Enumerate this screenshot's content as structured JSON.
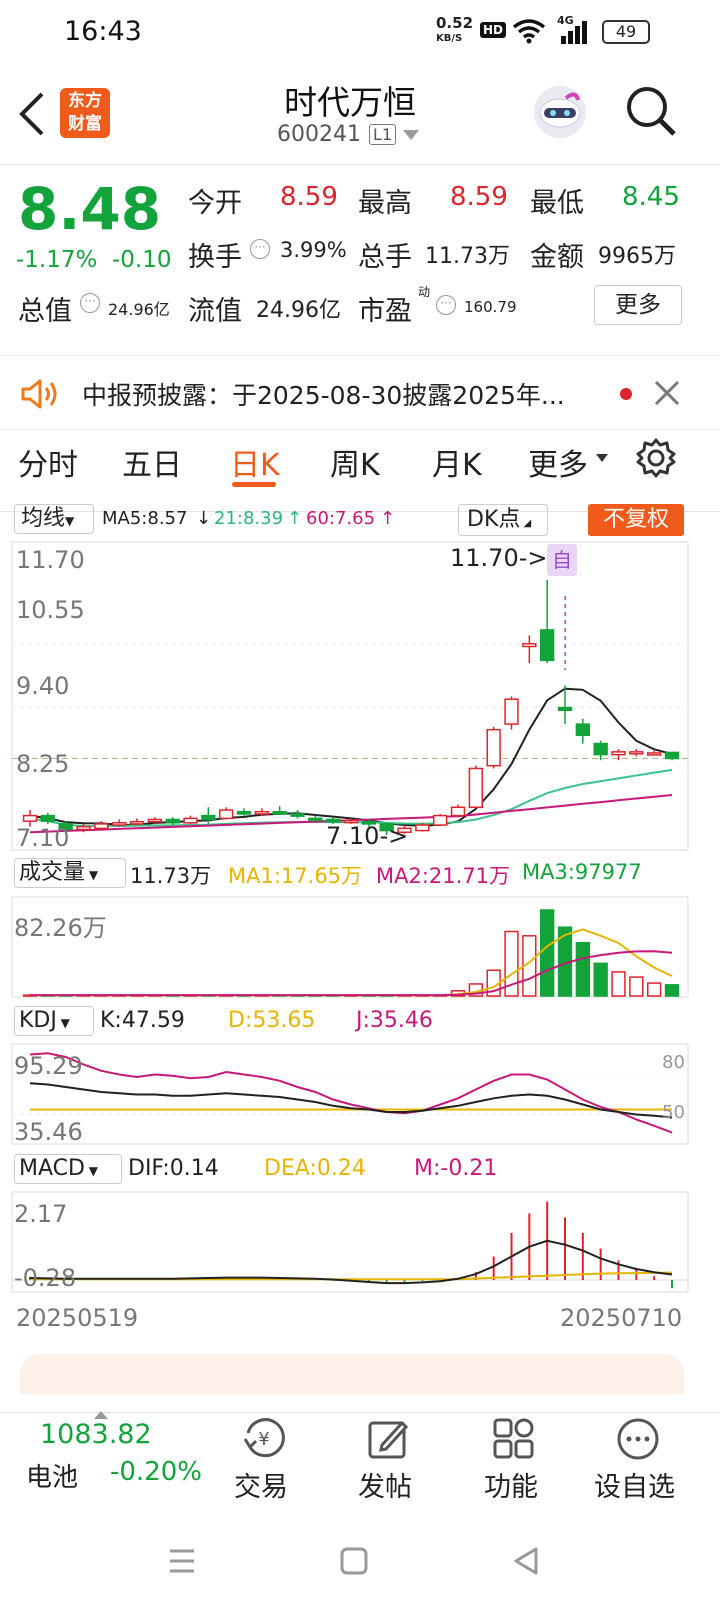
{
  "status_bar": {
    "time": "16:43",
    "net_speed": "0.52",
    "net_unit": "KB/S",
    "hd": "HD",
    "signal": "4G",
    "battery": "49"
  },
  "header": {
    "back_icon": "chevron-left-icon",
    "logo_text_1": "东方",
    "logo_text_2": "财富",
    "title": "时代万恒",
    "code": "600241",
    "level": "L1",
    "robot_icon": "robot-icon",
    "search_icon": "search-icon"
  },
  "quote": {
    "price": "8.48",
    "change_pct": "-1.17%",
    "change": "-0.10",
    "open_label": "今开",
    "open": "8.59",
    "high_label": "最高",
    "high": "8.59",
    "low_label": "最低",
    "low": "8.45",
    "turnover_label": "换手",
    "turnover": "3.99%",
    "volume_label": "总手",
    "volume": "11.73万",
    "amount_label": "金额",
    "amount": "9965万",
    "total_value_label": "总值",
    "total_value": "24.96亿",
    "float_value_label": "流值",
    "float_value": "24.96亿",
    "pe_label": "市盈",
    "pe_mark": "动",
    "pe": "160.79",
    "more_button": "更多"
  },
  "notice": {
    "icon": "speaker-icon",
    "text": "中报预披露：于2025-08-30披露2025年...",
    "close_icon": "close-icon"
  },
  "tabs": {
    "items": [
      "分时",
      "五日",
      "日K",
      "周K",
      "月K",
      "更多"
    ],
    "active": 2,
    "settings_icon": "gear-icon"
  },
  "kline_header": {
    "ma_select": "均线",
    "ma5": "MA5:8.57",
    "ma21": "21:8.39",
    "ma60": "60:7.65",
    "dk": "DK点",
    "adjust": "不复权"
  },
  "kline_axis": {
    "y1": "11.70",
    "y2": "10.55",
    "y3": "9.40",
    "y4": "8.25",
    "y5": "7.10",
    "high_marker": "11.70->",
    "low_marker": "7.10->",
    "self_tag": "自"
  },
  "volume_header": {
    "select": "成交量",
    "value": "11.73万",
    "ma1": "MA1:17.65万",
    "ma2": "MA2:21.71万",
    "ma3": "MA3:97977",
    "ymax": "82.26万"
  },
  "kdj_header": {
    "select": "KDJ",
    "k": "K:47.59",
    "d": "D:53.65",
    "j": "J:35.46",
    "ymax": "95.29",
    "ymin": "35.46",
    "ref80": "80",
    "ref50": "50"
  },
  "macd_header": {
    "select": "MACD",
    "dif": "DIF:0.14",
    "dea": "DEA:0.24",
    "m": "M:-0.21",
    "ymax": "2.17",
    "ymin": "-0.28"
  },
  "dates": {
    "start": "20250519",
    "end": "20250710"
  },
  "bottom": {
    "index_value": "1083.82",
    "index_name": "电池",
    "index_change": "-0.20%",
    "trade": "交易",
    "post": "发帖",
    "func": "功能",
    "watch": "设自选"
  },
  "colors": {
    "up": "#e0242b",
    "down": "#12a33b",
    "accent": "#ff6a00",
    "ma5": "#222222",
    "ma21": "#3cc48c",
    "ma60": "#c8187a",
    "yellow": "#e8b400"
  },
  "chart_data": {
    "type": "candlestick",
    "dates_range": [
      "20250519",
      "20250710"
    ],
    "ylim": [
      7.1,
      11.7
    ],
    "candles": [
      {
        "o": 7.35,
        "c": 7.45,
        "h": 7.55,
        "l": 7.25
      },
      {
        "o": 7.45,
        "c": 7.35,
        "h": 7.5,
        "l": 7.3
      },
      {
        "o": 7.3,
        "c": 7.2,
        "h": 7.35,
        "l": 7.15
      },
      {
        "o": 7.2,
        "c": 7.25,
        "h": 7.3,
        "l": 7.15
      },
      {
        "o": 7.22,
        "c": 7.3,
        "h": 7.35,
        "l": 7.18
      },
      {
        "o": 7.28,
        "c": 7.32,
        "h": 7.38,
        "l": 7.25
      },
      {
        "o": 7.3,
        "c": 7.34,
        "h": 7.4,
        "l": 7.28
      },
      {
        "o": 7.34,
        "c": 7.38,
        "h": 7.42,
        "l": 7.3
      },
      {
        "o": 7.38,
        "c": 7.32,
        "h": 7.42,
        "l": 7.28
      },
      {
        "o": 7.32,
        "c": 7.4,
        "h": 7.45,
        "l": 7.3
      },
      {
        "o": 7.45,
        "c": 7.38,
        "h": 7.6,
        "l": 7.3
      },
      {
        "o": 7.4,
        "c": 7.55,
        "h": 7.6,
        "l": 7.38
      },
      {
        "o": 7.52,
        "c": 7.48,
        "h": 7.58,
        "l": 7.45
      },
      {
        "o": 7.48,
        "c": 7.52,
        "h": 7.58,
        "l": 7.44
      },
      {
        "o": 7.52,
        "c": 7.48,
        "h": 7.62,
        "l": 7.46
      },
      {
        "o": 7.48,
        "c": 7.44,
        "h": 7.55,
        "l": 7.4
      },
      {
        "o": 7.4,
        "c": 7.38,
        "h": 7.45,
        "l": 7.35
      },
      {
        "o": 7.38,
        "c": 7.34,
        "h": 7.42,
        "l": 7.3
      },
      {
        "o": 7.34,
        "c": 7.36,
        "h": 7.4,
        "l": 7.3
      },
      {
        "o": 7.34,
        "c": 7.3,
        "h": 7.38,
        "l": 7.25
      },
      {
        "o": 7.3,
        "c": 7.18,
        "h": 7.32,
        "l": 7.1
      },
      {
        "o": 7.15,
        "c": 7.22,
        "h": 7.28,
        "l": 7.12
      },
      {
        "o": 7.18,
        "c": 7.28,
        "h": 7.32,
        "l": 7.16
      },
      {
        "o": 7.28,
        "c": 7.45,
        "h": 7.48,
        "l": 7.26
      },
      {
        "o": 7.45,
        "c": 7.6,
        "h": 7.65,
        "l": 7.42
      },
      {
        "o": 7.6,
        "c": 8.3,
        "h": 8.35,
        "l": 7.58
      },
      {
        "o": 8.35,
        "c": 9.0,
        "h": 9.05,
        "l": 8.3
      },
      {
        "o": 9.1,
        "c": 9.55,
        "h": 9.6,
        "l": 9.0
      },
      {
        "o": 10.5,
        "c": 10.55,
        "h": 10.7,
        "l": 10.2
      },
      {
        "o": 10.8,
        "c": 10.25,
        "h": 11.7,
        "l": 10.2
      },
      {
        "o": 9.4,
        "c": 9.35,
        "h": 9.8,
        "l": 9.1
      },
      {
        "o": 9.1,
        "c": 8.9,
        "h": 9.2,
        "l": 8.75
      },
      {
        "o": 8.75,
        "c": 8.55,
        "h": 8.8,
        "l": 8.45
      },
      {
        "o": 8.55,
        "c": 8.6,
        "h": 8.65,
        "l": 8.45
      },
      {
        "o": 8.58,
        "c": 8.6,
        "h": 8.65,
        "l": 8.52
      },
      {
        "o": 8.58,
        "c": 8.58,
        "h": 8.62,
        "l": 8.55
      },
      {
        "o": 8.59,
        "c": 8.48,
        "h": 8.59,
        "l": 8.45
      }
    ]
  }
}
